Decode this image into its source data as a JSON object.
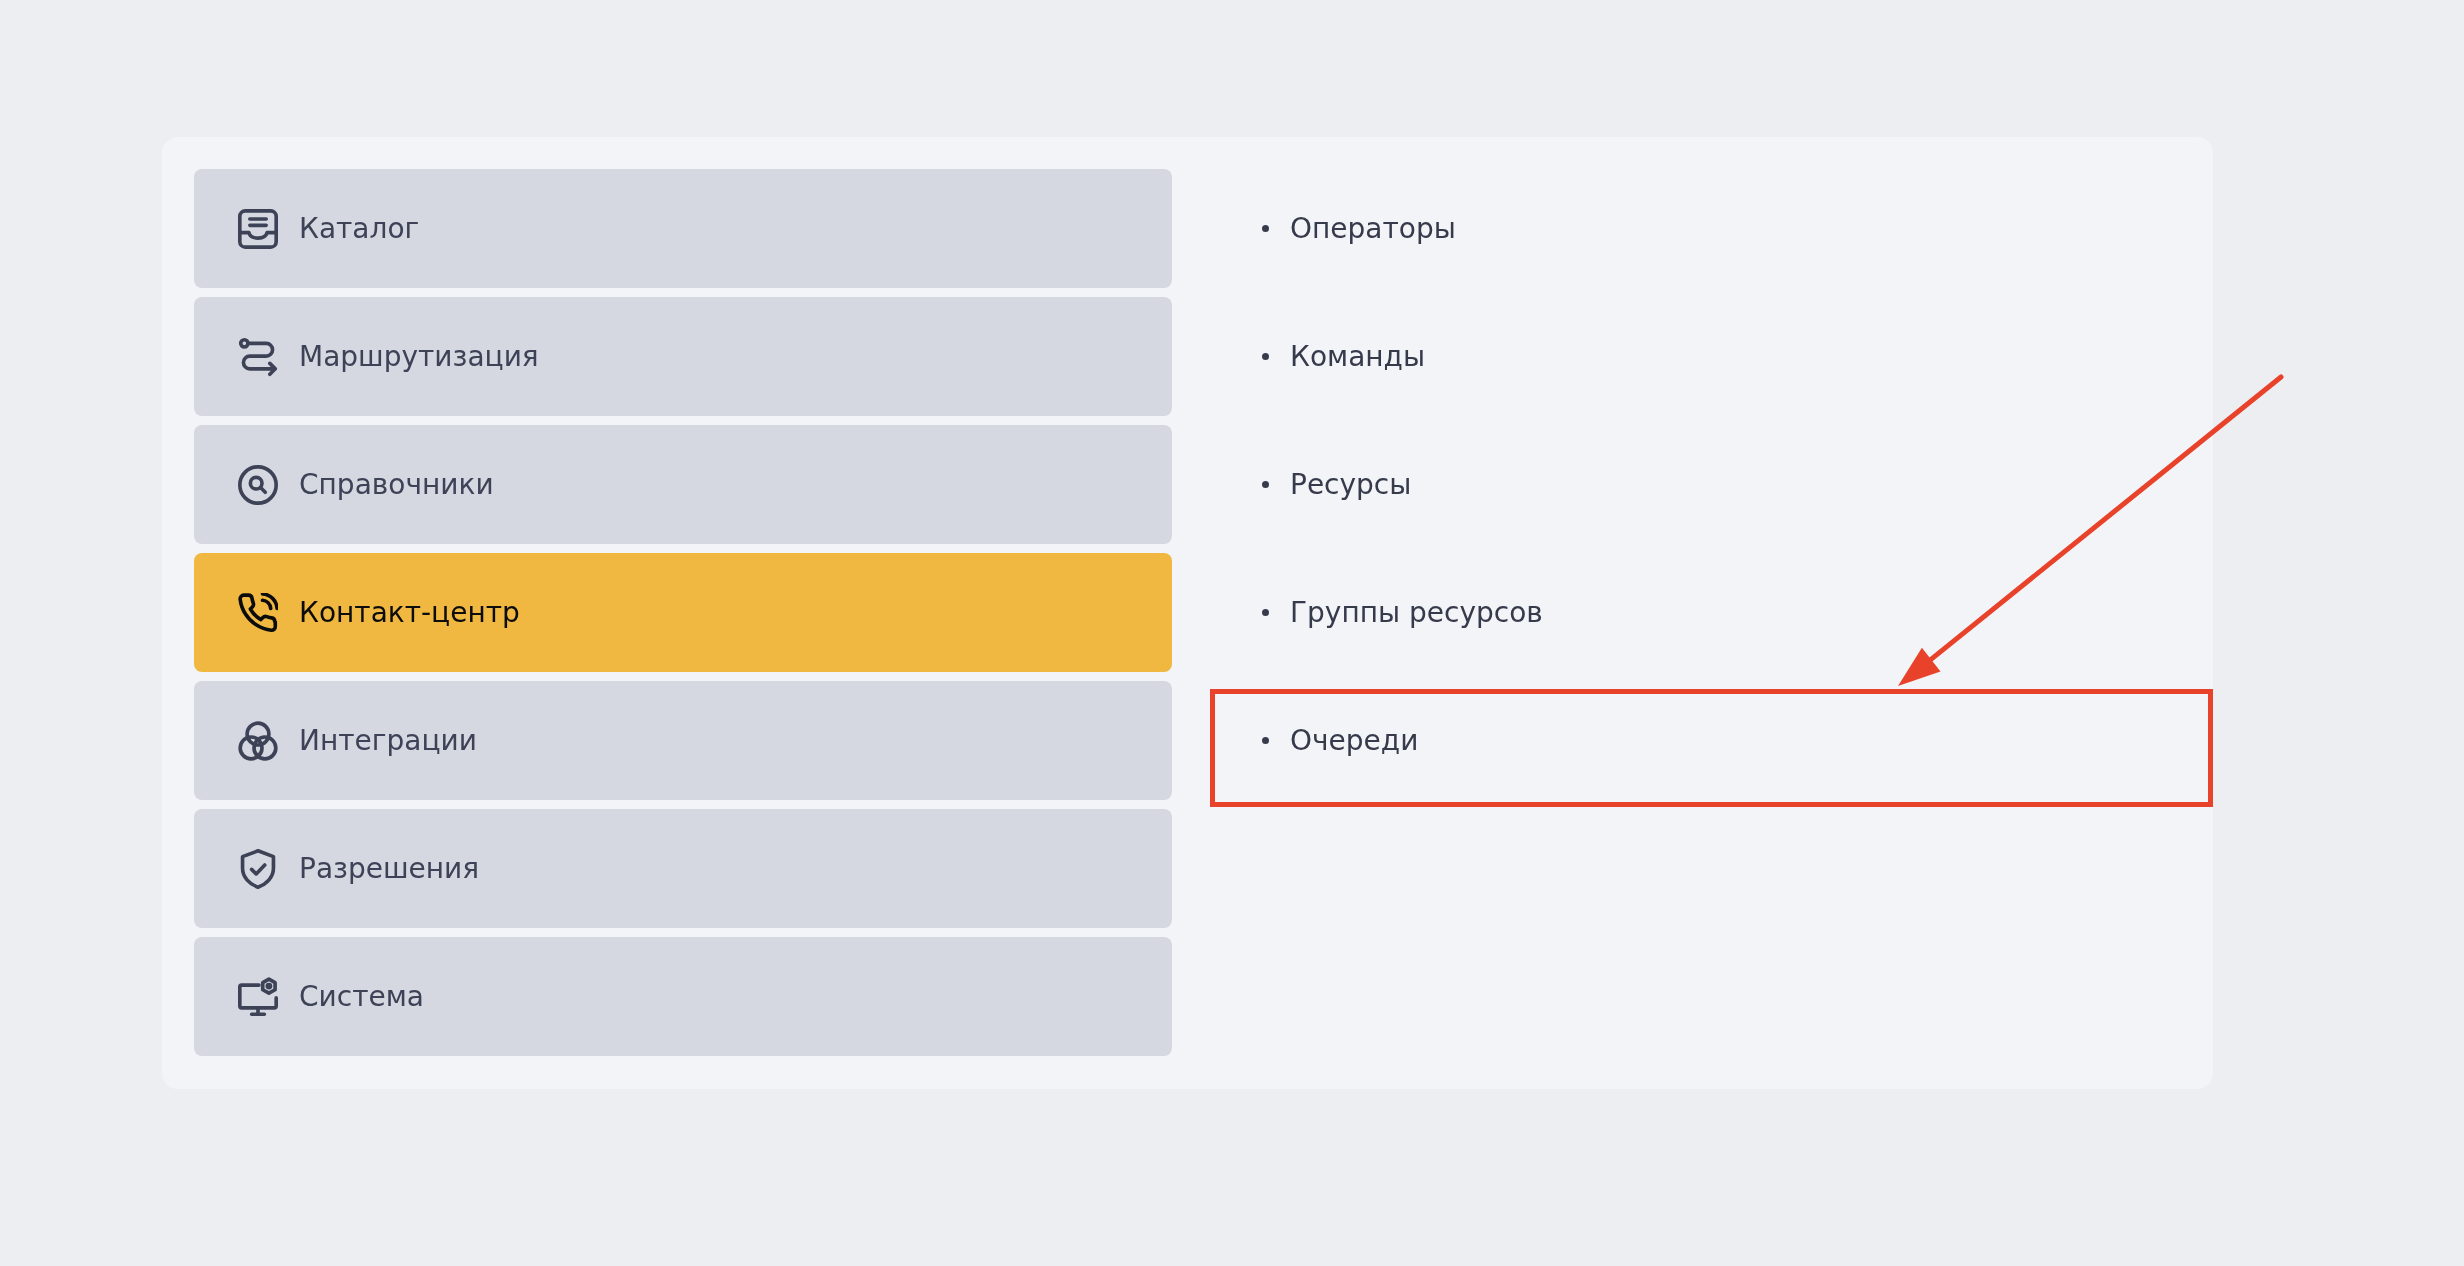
{
  "sidebar": {
    "items": [
      {
        "label": "Каталог",
        "selected": false
      },
      {
        "label": "Маршрутизация",
        "selected": false
      },
      {
        "label": "Справочники",
        "selected": false
      },
      {
        "label": "Контакт-центр",
        "selected": true
      },
      {
        "label": "Интеграции",
        "selected": false
      },
      {
        "label": "Разрешения",
        "selected": false
      },
      {
        "label": "Система",
        "selected": false
      }
    ]
  },
  "submenu": {
    "items": [
      {
        "label": "Операторы",
        "highlighted": false
      },
      {
        "label": "Команды",
        "highlighted": false
      },
      {
        "label": "Ресурсы",
        "highlighted": false
      },
      {
        "label": "Группы ресурсов",
        "highlighted": false
      },
      {
        "label": "Очереди",
        "highlighted": true
      }
    ]
  }
}
